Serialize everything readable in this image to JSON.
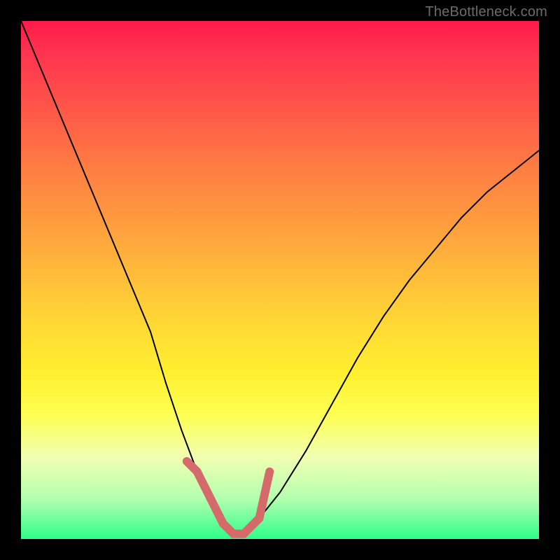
{
  "watermark": "TheBottleneck.com",
  "chart_data": {
    "type": "line",
    "title": "",
    "xlabel": "",
    "ylabel": "",
    "xlim": [
      0,
      100
    ],
    "ylim": [
      0,
      100
    ],
    "grid": false,
    "legend": false,
    "series": [
      {
        "name": "bottleneck-curve",
        "x": [
          0,
          5,
          10,
          15,
          20,
          25,
          28,
          31,
          34,
          37,
          39,
          41,
          43,
          46,
          50,
          55,
          60,
          65,
          70,
          75,
          80,
          85,
          90,
          95,
          100
        ],
        "y": [
          100,
          88,
          76,
          64,
          52,
          40,
          30,
          21,
          13,
          7,
          3,
          1,
          1,
          4,
          9,
          17,
          26,
          35,
          43,
          50,
          56,
          62,
          67,
          71,
          75
        ]
      }
    ],
    "highlight_region": {
      "name": "optimal-band",
      "x_range": [
        33,
        47
      ],
      "y_max": 15
    },
    "background_gradient": {
      "direction": "vertical",
      "stops": [
        {
          "pos": 0.0,
          "color": "#ff1a4a"
        },
        {
          "pos": 0.5,
          "color": "#ffd735"
        },
        {
          "pos": 0.8,
          "color": "#fdff52"
        },
        {
          "pos": 1.0,
          "color": "#2fff8a"
        }
      ]
    }
  }
}
